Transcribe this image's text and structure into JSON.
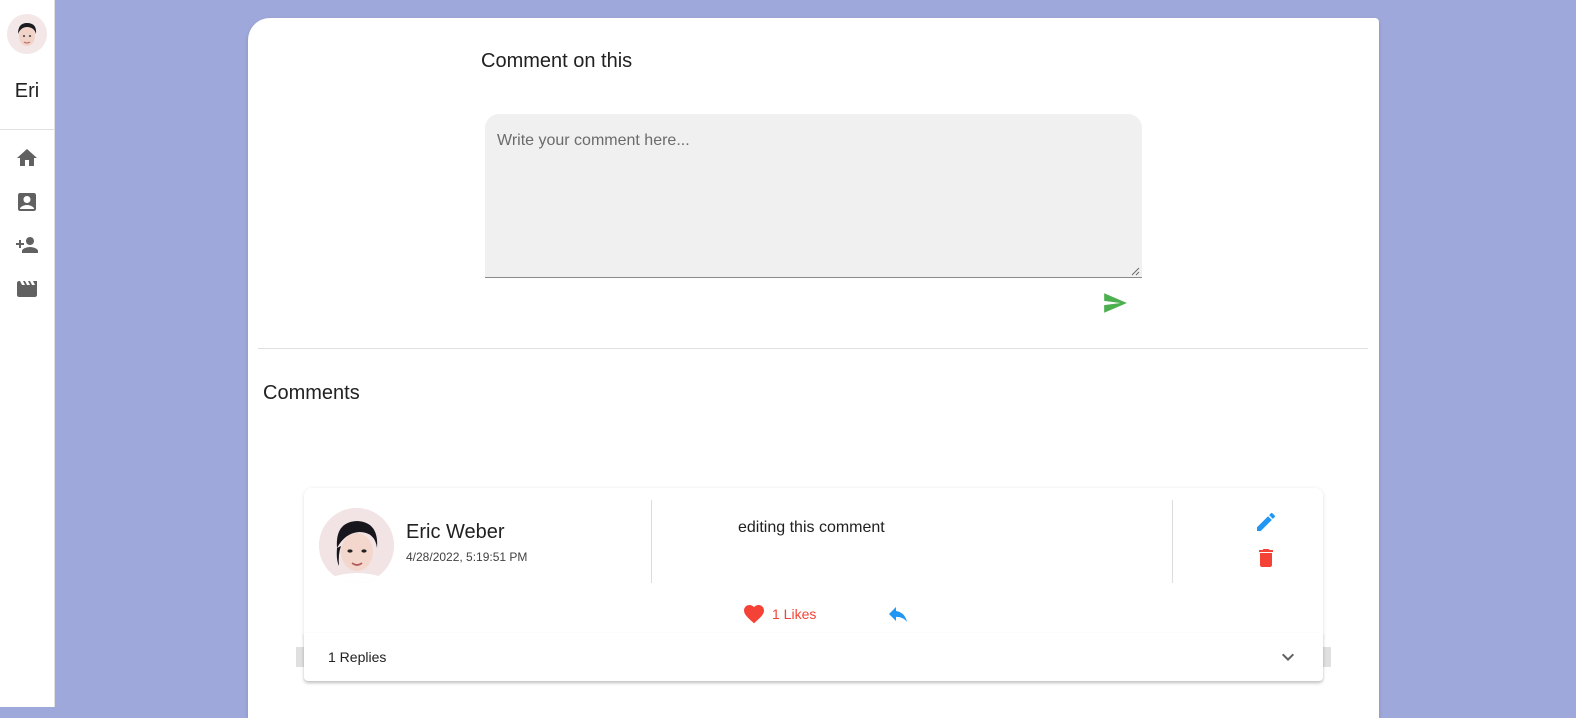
{
  "sidebar": {
    "user_short_name": "Eri",
    "nav": [
      {
        "icon": "home-icon"
      },
      {
        "icon": "contact-card-icon"
      },
      {
        "icon": "person-add-icon"
      },
      {
        "icon": "movie-icon"
      }
    ]
  },
  "composer": {
    "title": "Comment on this",
    "placeholder": "Write your comment here...",
    "send_icon": "send-icon"
  },
  "comments_section": {
    "heading": "Comments",
    "items": [
      {
        "author": "Eric Weber",
        "date": "4/28/2022, 5:19:51 PM",
        "text": "editing this comment",
        "likes_label": "1 Likes",
        "replies_label": "1 Replies"
      }
    ]
  },
  "colors": {
    "background": "#9fa8da",
    "send": "#4caf50",
    "edit": "#2196f3",
    "delete": "#f44336",
    "like": "#f44336",
    "reply": "#2196f3"
  }
}
